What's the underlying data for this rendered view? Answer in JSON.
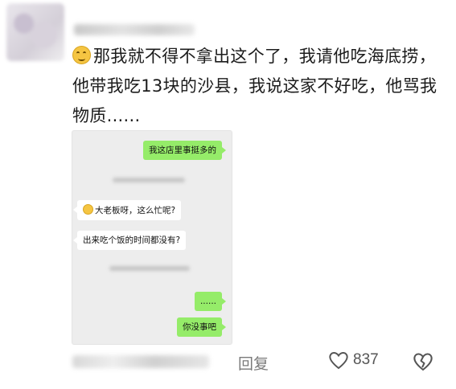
{
  "comment": {
    "text": "那我就不得不拿出这个了，我请他吃海底捞，他带我吃13块的沙县，我说这家不好吃，他骂我物质......"
  },
  "chat": {
    "msg1": "我这店里事挺多的",
    "msg2": "大老板呀，这么忙呢?",
    "msg3": "出来吃个饭的时间都没有?",
    "msg4": "......",
    "msg5": "你没事吧"
  },
  "actions": {
    "reply_label": "回复",
    "like_count": "837"
  },
  "colors": {
    "my_bubble": "#95ec69",
    "chat_bg": "#ededed"
  },
  "icons": {
    "emoji": "grinning-face-icon",
    "like": "heart-outline-icon",
    "dislike": "broken-heart-icon"
  }
}
